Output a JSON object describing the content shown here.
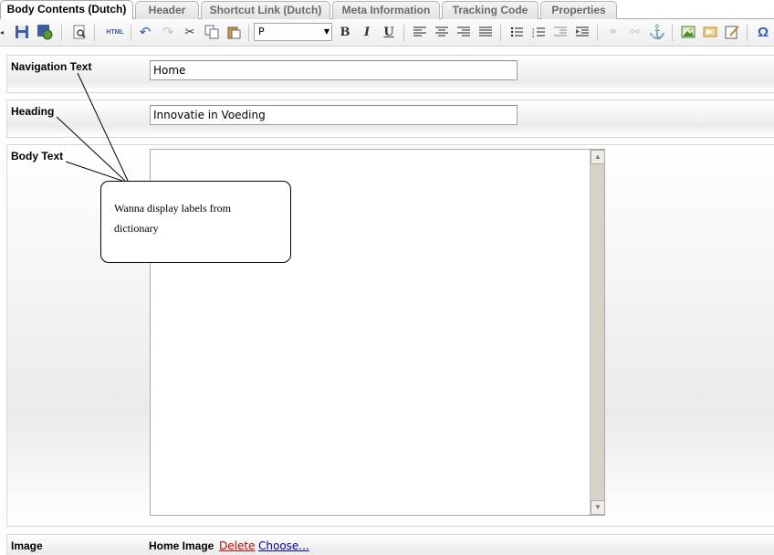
{
  "tabs": [
    {
      "label": "Body Contents (Dutch)",
      "active": true
    },
    {
      "label": "Header",
      "active": false
    },
    {
      "label": "Shortcut Link (Dutch)",
      "active": false
    },
    {
      "label": "Meta Information",
      "active": false
    },
    {
      "label": "Tracking Code",
      "active": false
    },
    {
      "label": "Properties",
      "active": false
    }
  ],
  "toolbar": {
    "html_label": "HTML",
    "format_value": "P",
    "bold": "B",
    "italic": "I",
    "underline": "U",
    "omega": "Ω",
    "icons": [
      "collapse-arrow-icon",
      "save-icon",
      "save-globe-icon",
      "preview-icon",
      "html-source-icon",
      "undo-icon",
      "redo-icon",
      "cut-icon",
      "copy-icon",
      "paste-icon",
      "format-select",
      "bold-icon",
      "italic-icon",
      "underline-icon",
      "align-left-icon",
      "align-center-icon",
      "align-right-icon",
      "justify-icon",
      "bullet-list-icon",
      "numbered-list-icon",
      "outdent-icon",
      "indent-icon",
      "link-icon",
      "unlink-icon",
      "anchor-icon",
      "image-icon",
      "media-icon",
      "edit-form-icon",
      "special-char-icon"
    ]
  },
  "fields": {
    "navigation_text": {
      "label": "Navigation Text",
      "value": "Home"
    },
    "heading": {
      "label": "Heading",
      "value": "Innovatie in Voeding"
    },
    "body_text": {
      "label": "Body Text"
    }
  },
  "callout": {
    "line1": "Wanna display labels from",
    "line2": "dictionary"
  },
  "image_row": {
    "label": "Image",
    "value": "Home Image",
    "delete_label": "Delete",
    "choose_label": "Choose..."
  },
  "colors": {
    "delete_link": "#cc0000",
    "choose_link": "#0000aa"
  }
}
